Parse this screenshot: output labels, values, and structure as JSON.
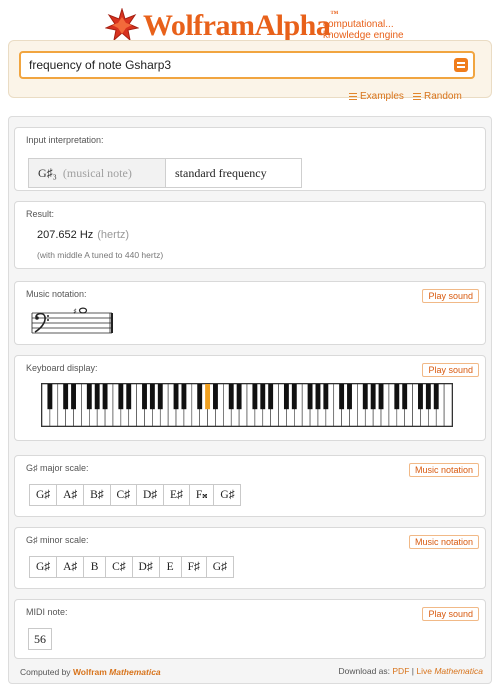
{
  "header": {
    "logo_word": "WolframAlpha",
    "tagline_1": "computational...",
    "tagline_2": "knowledge engine",
    "accent_color": "#e8611a"
  },
  "search": {
    "value": "frequency of note Gsharp3",
    "go_icon": "equals-icon"
  },
  "links": {
    "examples": "Examples",
    "random": "Random"
  },
  "pods": {
    "input": {
      "title": "Input interpretation:",
      "note": "G♯₃",
      "note_kind": "(musical note)",
      "property": "standard frequency"
    },
    "result": {
      "title": "Result:",
      "value": "207.652 Hz",
      "unit": "(hertz)",
      "note": "(with middle A tuned to 440 hertz)"
    },
    "notation": {
      "title": "Music notation:",
      "button": "Play sound"
    },
    "keyboard": {
      "title": "Keyboard display:",
      "button": "Play sound",
      "highlight_color": "#f0a020"
    },
    "major": {
      "title": "G♯ major scale:",
      "button": "Music notation",
      "notes": [
        "G♯",
        "A♯",
        "B♯",
        "C♯",
        "D♯",
        "E♯",
        "F𝄪",
        "G♯"
      ]
    },
    "minor": {
      "title": "G♯ minor scale:",
      "button": "Music notation",
      "notes": [
        "G♯",
        "A♯",
        "B",
        "C♯",
        "D♯",
        "E",
        "F♯",
        "G♯"
      ]
    },
    "midi": {
      "title": "MIDI note:",
      "button": "Play sound",
      "value": "56"
    }
  },
  "footer": {
    "computed_by": "Computed by",
    "wolfram": "Wolfram",
    "mathematica": "Mathematica",
    "download_as": "Download as:",
    "pdf": "PDF",
    "sep": "|",
    "live": "Live",
    "live_math": "Mathematica"
  }
}
